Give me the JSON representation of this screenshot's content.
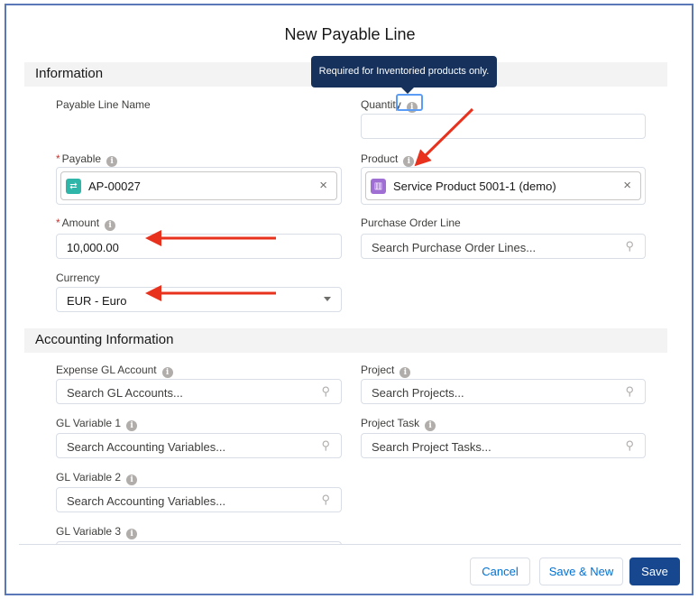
{
  "modal": {
    "title": "New Payable Line"
  },
  "sections": {
    "information": "Information",
    "accounting": "Accounting Information"
  },
  "tooltip": {
    "text": "Required for Inventoried products only."
  },
  "fields": {
    "payable_line_name": {
      "label": "Payable Line Name",
      "value": ""
    },
    "quantity": {
      "label": "Quantity",
      "value": ""
    },
    "payable": {
      "label": "Payable",
      "required_mark": "*",
      "value": "AP-00027",
      "icon": "payable-record-icon",
      "icon_color": "#2fb6a8"
    },
    "product": {
      "label": "Product",
      "value": "Service Product 5001-1 (demo)",
      "icon": "product-record-icon",
      "icon_color": "#a06fd3"
    },
    "amount": {
      "label": "Amount",
      "required_mark": "*",
      "value": "10,000.00"
    },
    "purchase_order_line": {
      "label": "Purchase Order Line",
      "placeholder": "Search Purchase Order Lines..."
    },
    "currency": {
      "label": "Currency",
      "value": "EUR - Euro"
    },
    "expense_gl_account": {
      "label": "Expense GL Account",
      "placeholder": "Search GL Accounts..."
    },
    "project": {
      "label": "Project",
      "placeholder": "Search Projects..."
    },
    "gl_variable_1": {
      "label": "GL Variable 1",
      "placeholder": "Search Accounting Variables..."
    },
    "project_task": {
      "label": "Project Task",
      "placeholder": "Search Project Tasks..."
    },
    "gl_variable_2": {
      "label": "GL Variable 2",
      "placeholder": "Search Accounting Variables..."
    },
    "gl_variable_3": {
      "label": "GL Variable 3"
    }
  },
  "info_glyph": "i",
  "search_glyph": "⚲",
  "clear_glyph": "×",
  "footer": {
    "cancel": "Cancel",
    "save_new": "Save & New",
    "save": "Save"
  },
  "colors": {
    "primary": "#16478f",
    "link": "#0070d2",
    "tooltip_bg": "#16325c",
    "annotation_arrow": "#e8321e",
    "frame": "#5a78b8"
  }
}
